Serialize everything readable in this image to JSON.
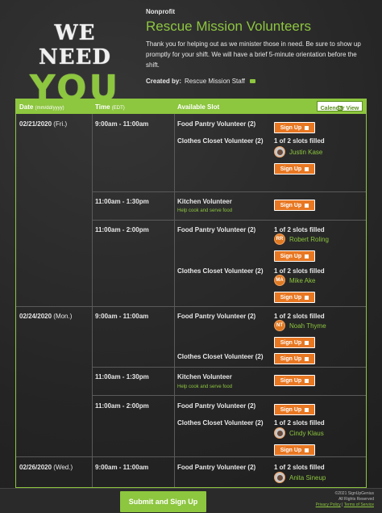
{
  "logo": {
    "line1": "WE NEED",
    "line2": "YOU"
  },
  "header": {
    "category": "Nonprofit",
    "title": "Rescue Mission Volunteers",
    "description": "Thank you for helping out as we minister those in need. Be sure to show up promptly for your shift. We will have a brief 5-minute orientation before the shift.",
    "created_label": "Created by:",
    "created_by": "Rescue Mission Staff"
  },
  "table": {
    "col_date": "Date",
    "col_date_sub": "(mm/dd/yyyy)",
    "col_time": "Time",
    "col_time_sub": "(EDT)",
    "col_slot": "Available Slot",
    "calendar_view": "Calendar View",
    "signup_label": "Sign Up",
    "dates": [
      {
        "date": "02/21/2020",
        "day": "(Fri.)"
      },
      {
        "date": "02/24/2020",
        "day": "(Mon.)"
      },
      {
        "date": "02/26/2020",
        "day": "(Wed.)"
      }
    ],
    "times": [
      "9:00am - 11:00am",
      "11:00am - 1:30pm",
      "11:00am - 2:00pm",
      "9:00am - 11:00am",
      "11:00am - 1:30pm",
      "11:00am - 2:00pm",
      "9:00am - 11:00am"
    ],
    "slots": [
      {
        "name": "Food Pantry Volunteer (2)"
      },
      {
        "name": "Clothes Closet Volunteer (2)",
        "filled": "1 of 2 slots filled",
        "person": "Justin Kase"
      },
      {
        "name": "Kitchen Volunteer",
        "note": "Help cook and serve food"
      },
      {
        "name": "Food Pantry Volunteer (2)",
        "filled": "1 of 2 slots filled",
        "person": "Robert Roling",
        "initials": "RR"
      },
      {
        "name": "Clothes Closet Volunteer (2)",
        "filled": "1 of 2 slots filled",
        "person": "Mike Ake",
        "initials": "MA"
      },
      {
        "name": "Food Pantry Volunteer (2)",
        "filled": "1 of 2 slots filled",
        "person": "Noah Thyme",
        "initials": "NT"
      },
      {
        "name": "Clothes Closet Volunteer (2)"
      },
      {
        "name": "Kitchen Volunteer",
        "note": "Help cook and serve food"
      },
      {
        "name": "Food Pantry Volunteer (2)"
      },
      {
        "name": "Clothes Closet Volunteer (2)",
        "filled": "1 of 2 slots filled",
        "person": "Cindy Klaus"
      },
      {
        "name": "Food Pantry Volunteer (2)",
        "filled": "1 of 2 slots filled",
        "person": "Anita Sineup"
      }
    ]
  },
  "footer": {
    "submit": "Submit and Sign Up",
    "copyright": "©2021 SignUpGenius",
    "rights": "All Rights Reserved",
    "privacy": "Privacy Policy",
    "separator": "|",
    "terms": "Terms of Service"
  },
  "colors": {
    "accent": "#8dc63f",
    "button": "#e87722",
    "background": "#2a2a2a"
  }
}
